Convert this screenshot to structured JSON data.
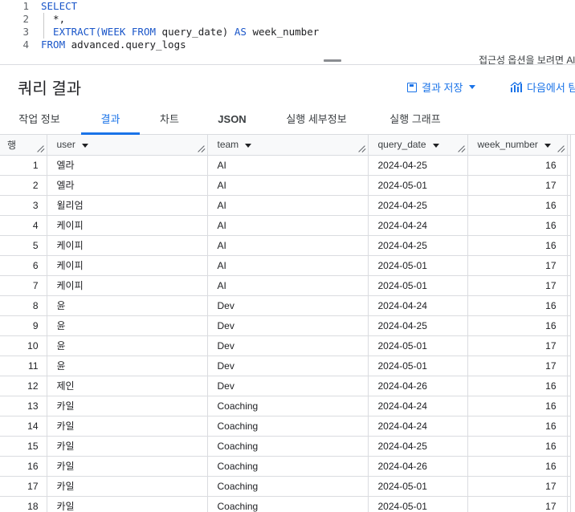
{
  "editor": {
    "lines": [
      {
        "num": "1",
        "kw1": "SELECT",
        "rest": ""
      },
      {
        "num": "2",
        "text": "  *,"
      },
      {
        "num": "3",
        "fn": "  EXTRACT(",
        "kw_week": "WEEK",
        "kw_from": "FROM",
        "col": "query_date)",
        "kw_as": "AS",
        "alias": "week_number"
      },
      {
        "num": "4",
        "kw_from": "FROM",
        "table": "advanced.query_logs"
      }
    ],
    "accessibility_hint": "접근성 옵션을 보려면 Al"
  },
  "results": {
    "title": "쿼리 결과",
    "save_label": "결과 저장",
    "explore_label": "다음에서 탐"
  },
  "tabs": [
    {
      "label": "작업 정보"
    },
    {
      "label": "결과"
    },
    {
      "label": "차트"
    },
    {
      "label": "JSON"
    },
    {
      "label": "실행 세부정보"
    },
    {
      "label": "실행 그래프"
    }
  ],
  "table": {
    "headers": {
      "row": "행",
      "user": "user",
      "team": "team",
      "query_date": "query_date",
      "week_number": "week_number"
    },
    "rows": [
      {
        "n": "1",
        "user": "엘라",
        "team": "AI",
        "date": "2024-04-25",
        "week": "16"
      },
      {
        "n": "2",
        "user": "엘라",
        "team": "AI",
        "date": "2024-05-01",
        "week": "17"
      },
      {
        "n": "3",
        "user": "윌리엄",
        "team": "AI",
        "date": "2024-04-25",
        "week": "16"
      },
      {
        "n": "4",
        "user": "케이피",
        "team": "AI",
        "date": "2024-04-24",
        "week": "16"
      },
      {
        "n": "5",
        "user": "케이피",
        "team": "AI",
        "date": "2024-04-25",
        "week": "16"
      },
      {
        "n": "6",
        "user": "케이피",
        "team": "AI",
        "date": "2024-05-01",
        "week": "17"
      },
      {
        "n": "7",
        "user": "케이피",
        "team": "AI",
        "date": "2024-05-01",
        "week": "17"
      },
      {
        "n": "8",
        "user": "윤",
        "team": "Dev",
        "date": "2024-04-24",
        "week": "16"
      },
      {
        "n": "9",
        "user": "윤",
        "team": "Dev",
        "date": "2024-04-25",
        "week": "16"
      },
      {
        "n": "10",
        "user": "윤",
        "team": "Dev",
        "date": "2024-05-01",
        "week": "17"
      },
      {
        "n": "11",
        "user": "윤",
        "team": "Dev",
        "date": "2024-05-01",
        "week": "17"
      },
      {
        "n": "12",
        "user": "제인",
        "team": "Dev",
        "date": "2024-04-26",
        "week": "16"
      },
      {
        "n": "13",
        "user": "카일",
        "team": "Coaching",
        "date": "2024-04-24",
        "week": "16"
      },
      {
        "n": "14",
        "user": "카일",
        "team": "Coaching",
        "date": "2024-04-24",
        "week": "16"
      },
      {
        "n": "15",
        "user": "카일",
        "team": "Coaching",
        "date": "2024-04-25",
        "week": "16"
      },
      {
        "n": "16",
        "user": "카일",
        "team": "Coaching",
        "date": "2024-04-26",
        "week": "16"
      },
      {
        "n": "17",
        "user": "카일",
        "team": "Coaching",
        "date": "2024-05-01",
        "week": "17"
      },
      {
        "n": "18",
        "user": "카일",
        "team": "Coaching",
        "date": "2024-05-01",
        "week": "17"
      }
    ]
  },
  "colors": {
    "accent": "#1a73e8",
    "keyword": "#1a56c9",
    "border": "#dadce0"
  }
}
